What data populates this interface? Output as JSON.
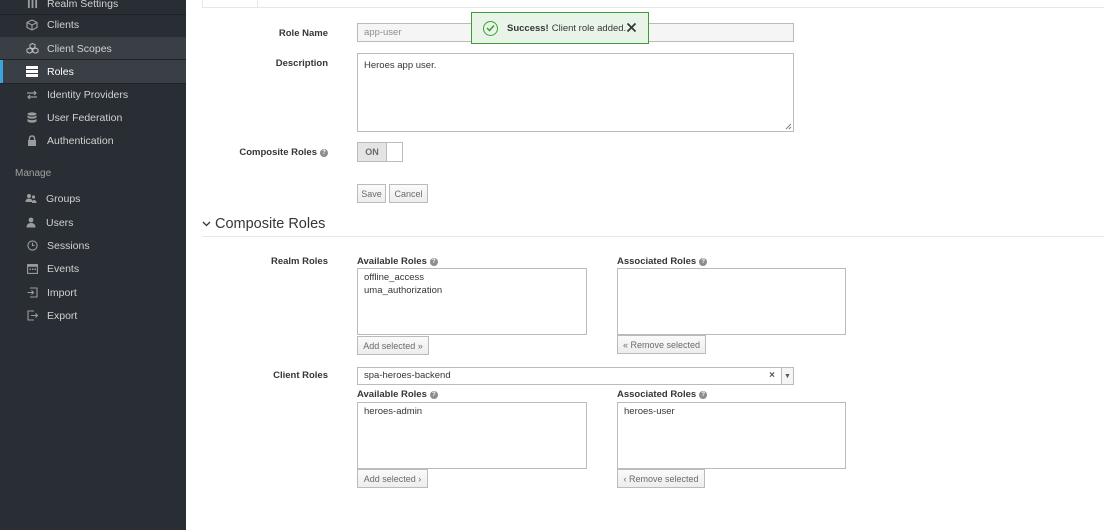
{
  "sidebar": {
    "items": [
      {
        "label": "Realm Settings",
        "icon": "sliders-icon"
      },
      {
        "label": "Clients",
        "icon": "cube-icon"
      },
      {
        "label": "Client Scopes",
        "icon": "cubes-icon"
      },
      {
        "label": "Roles",
        "icon": "list-icon"
      },
      {
        "label": "Identity Providers",
        "icon": "exchange-icon"
      },
      {
        "label": "User Federation",
        "icon": "database-icon"
      },
      {
        "label": "Authentication",
        "icon": "lock-icon"
      }
    ],
    "manage_label": "Manage",
    "manage_items": [
      {
        "label": "Groups",
        "icon": "users-icon"
      },
      {
        "label": "Users",
        "icon": "user-icon"
      },
      {
        "label": "Sessions",
        "icon": "clock-icon"
      },
      {
        "label": "Events",
        "icon": "calendar-icon"
      },
      {
        "label": "Import",
        "icon": "import-icon"
      },
      {
        "label": "Export",
        "icon": "export-icon"
      }
    ],
    "active_color": "#39a5dc"
  },
  "form": {
    "role_name_label": "Role Name",
    "role_name_value": "app-user",
    "description_label": "Description",
    "description_value": "Heroes app user.",
    "composite_label": "Composite Roles",
    "composite_toggle": "ON",
    "save_label": "Save",
    "cancel_label": "Cancel"
  },
  "toast": {
    "strong": "Success!",
    "message": "Client role added.",
    "color": "#3f9c35"
  },
  "composite": {
    "title": "Composite Roles",
    "realm_label": "Realm Roles",
    "available_label": "Available Roles",
    "associated_label": "Associated Roles",
    "realm_available": [
      "offline_access",
      "uma_authorization"
    ],
    "realm_associated": [],
    "add_selected": "Add selected »",
    "remove_selected": "« Remove selected",
    "client_label": "Client Roles",
    "client_select_value": "spa-heroes-backend",
    "client_available": [
      "heroes-admin"
    ],
    "client_associated": [
      "heroes-user"
    ],
    "client_add_selected": "Add selected ›",
    "client_remove_selected": "‹ Remove selected"
  }
}
